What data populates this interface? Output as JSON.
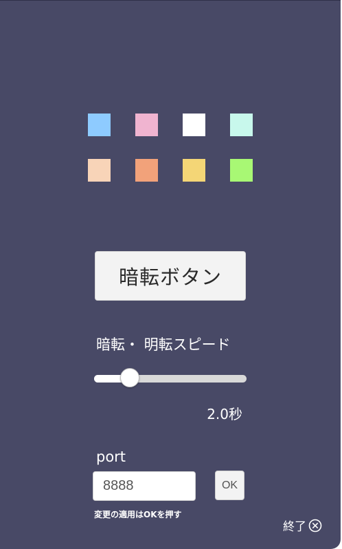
{
  "colors": {
    "background": "#484966",
    "palette": [
      "#8ecbff",
      "#f0b4d0",
      "#ffffff",
      "#c8f8ec",
      "#f8d4b8",
      "#f2a27a",
      "#f4d676",
      "#a8f874"
    ]
  },
  "palette_icons": [
    "color-swatch",
    "color-swatch",
    "color-swatch",
    "color-swatch",
    "color-swatch",
    "color-swatch",
    "color-swatch",
    "color-swatch"
  ],
  "blackout_button": {
    "label": "暗転ボタン"
  },
  "speed": {
    "label": "暗転・ 明転スピード",
    "value_text": "2.0秒",
    "slider_fraction": 0.235
  },
  "port": {
    "label": "port",
    "value": "8888",
    "ok_label": "OK",
    "note": "変更の適用はOKを押す"
  },
  "exit": {
    "label": "終了",
    "icon": "close-circle-icon"
  }
}
